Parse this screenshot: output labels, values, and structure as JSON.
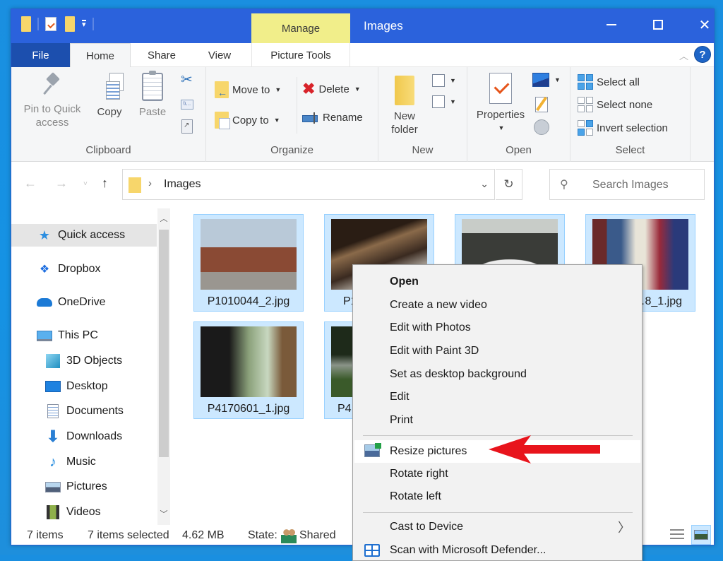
{
  "window": {
    "title": "Images",
    "contextual_tab_group": "Manage",
    "controls": {
      "minimize": "minimize",
      "maximize": "maximize",
      "close": "close"
    }
  },
  "quick_access_toolbar": {
    "icons": [
      "folder-icon",
      "properties-icon",
      "new-folder-icon",
      "customize-dropdown-icon"
    ]
  },
  "ribbon_tabs": [
    {
      "label": "File",
      "active": false
    },
    {
      "label": "Home",
      "active": true
    },
    {
      "label": "Share",
      "active": false
    },
    {
      "label": "View",
      "active": false
    },
    {
      "label": "Picture Tools",
      "active": false
    }
  ],
  "ribbon": {
    "clipboard": {
      "label": "Clipboard",
      "pin": "Pin to Quick access",
      "pin_line1": "Pin to Quick",
      "pin_line2": "access",
      "copy": "Copy",
      "paste": "Paste"
    },
    "organize": {
      "label": "Organize",
      "move_to": "Move to",
      "copy_to": "Copy to",
      "delete": "Delete",
      "rename": "Rename"
    },
    "new": {
      "label": "New",
      "new_folder_line1": "New",
      "new_folder_line2": "folder"
    },
    "open": {
      "label": "Open",
      "properties": "Properties"
    },
    "select": {
      "label": "Select",
      "select_all": "Select all",
      "select_none": "Select none",
      "invert_selection": "Invert selection"
    }
  },
  "address_bar": {
    "path": [
      "Images"
    ],
    "separator": "›"
  },
  "search": {
    "placeholder": "Search Images"
  },
  "nav_pane": {
    "items": [
      {
        "label": "Quick access",
        "icon": "star-icon",
        "selected": true
      },
      {
        "label": "Dropbox",
        "icon": "dropbox-icon"
      },
      {
        "label": "OneDrive",
        "icon": "cloud-icon"
      },
      {
        "label": "This PC",
        "icon": "computer-icon"
      },
      {
        "label": "3D Objects",
        "icon": "cube-icon"
      },
      {
        "label": "Desktop",
        "icon": "desktop-icon"
      },
      {
        "label": "Documents",
        "icon": "document-icon"
      },
      {
        "label": "Downloads",
        "icon": "download-icon"
      },
      {
        "label": "Music",
        "icon": "music-icon"
      },
      {
        "label": "Pictures",
        "icon": "pictures-icon"
      },
      {
        "label": "Videos",
        "icon": "video-icon"
      }
    ]
  },
  "files": [
    {
      "name": "P1010044_2.jpg",
      "selected": true
    },
    {
      "name": "P1…",
      "selected": true
    },
    {
      "name": "",
      "selected": true
    },
    {
      "name": "…8_1.jpg",
      "selected": true
    },
    {
      "name": "P4170601_1.jpg",
      "selected": true
    },
    {
      "name": "P4…",
      "selected": true
    }
  ],
  "status_bar": {
    "item_count": "7 items",
    "selected": "7 items selected",
    "size": "4.62 MB",
    "state_label": "State:",
    "state_value": "Shared"
  },
  "context_menu": {
    "items": [
      {
        "label": "Open",
        "bold": true
      },
      {
        "label": "Create a new video"
      },
      {
        "label": "Edit with Photos"
      },
      {
        "label": "Edit with Paint 3D"
      },
      {
        "label": "Set as desktop background"
      },
      {
        "label": "Edit"
      },
      {
        "label": "Print"
      },
      {
        "label": "Resize pictures",
        "icon": "resize-pictures-icon",
        "highlighted": true
      },
      {
        "label": "Rotate right"
      },
      {
        "label": "Rotate left"
      },
      {
        "label": "Cast to Device",
        "submenu": true
      },
      {
        "label": "Scan with Microsoft Defender...",
        "icon": "defender-icon"
      }
    ]
  },
  "annotation": {
    "type": "arrow",
    "color": "#e8141c",
    "points_to": "Resize pictures"
  },
  "colors": {
    "titlebar": "#2b62dc",
    "file_tab": "#1c4fae",
    "manage_tab": "#f1ee8a",
    "selection": "#cce8ff",
    "selection_border": "#99d1ff",
    "desktop": "#1592e4"
  }
}
